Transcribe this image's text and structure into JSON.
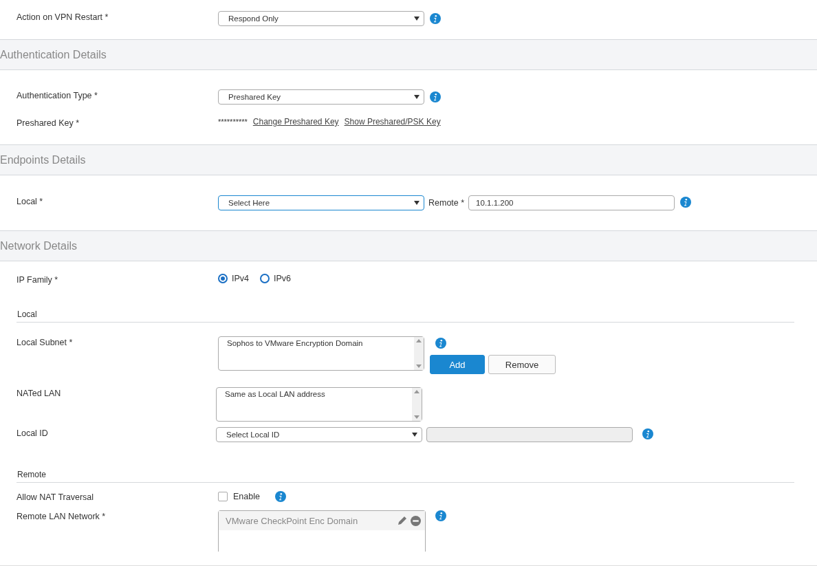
{
  "form": [
    {
      "kind": "select",
      "label": "Action on VPN Restart *",
      "value": "Respond Only",
      "info": true,
      "focused": false
    },
    {
      "kind": "section",
      "title": "Authentication Details"
    },
    {
      "kind": "select",
      "label": "Authentication Type *",
      "value": "Preshared Key",
      "info": true,
      "focused": false
    },
    {
      "kind": "key",
      "label": "Preshared Key *",
      "masked": "**********",
      "links": [
        "Change Preshared Key",
        "Show Preshared/PSK Key"
      ]
    },
    {
      "kind": "section",
      "title": "Endpoints Details"
    },
    {
      "kind": "endpoint",
      "label": "Local *",
      "value": "Select Here",
      "focused": true,
      "remote_label": "Remote *",
      "remote_value": "10.1.1.200",
      "info": true
    },
    {
      "kind": "section",
      "title": "Network Details"
    },
    {
      "kind": "radio",
      "label": "IP Family *",
      "options": [
        {
          "label": "IPv4",
          "selected": true
        },
        {
          "label": "IPv6",
          "selected": false
        }
      ]
    },
    {
      "kind": "subheader",
      "title": "Local"
    },
    {
      "kind": "listbox",
      "label": "Local Subnet *",
      "value": "Sophos to VMware Encryption Domain",
      "info": true,
      "buttons": [
        "Add",
        "Remove"
      ]
    },
    {
      "kind": "listbox",
      "label": "NATed LAN",
      "value": "Same as Local LAN address"
    },
    {
      "kind": "localid",
      "label": "Local ID",
      "value": "Select Local ID",
      "info": true,
      "focused": false
    },
    {
      "kind": "subheader",
      "title": "Remote"
    },
    {
      "kind": "checkbox",
      "label": "Allow NAT Traversal",
      "option": "Enable",
      "checked": false,
      "info": true
    },
    {
      "kind": "remotelist",
      "label": "Remote LAN Network *",
      "item": "VMware CheckPoint Enc Domain",
      "info": true
    }
  ]
}
